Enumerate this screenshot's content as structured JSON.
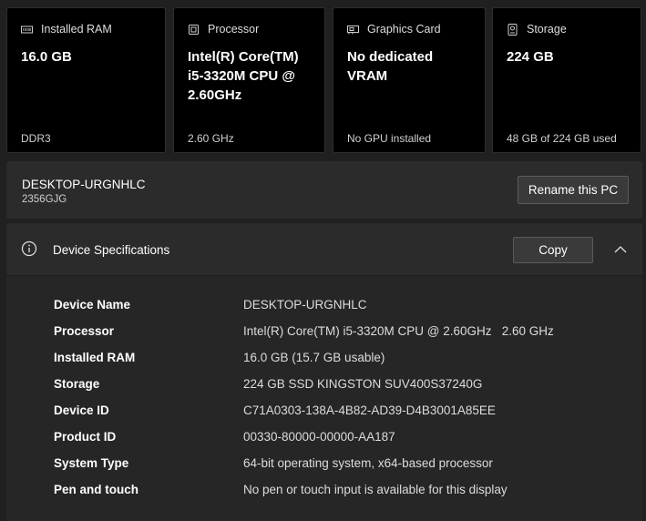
{
  "tiles": [
    {
      "icon": "ram-icon",
      "label": "Installed RAM",
      "value": "16.0 GB",
      "footer": "DDR3"
    },
    {
      "icon": "processor-icon",
      "label": "Processor",
      "value": "Intel(R) Core(TM) i5-3320M CPU @ 2.60GHz",
      "footer": "2.60 GHz"
    },
    {
      "icon": "graphics-card-icon",
      "label": "Graphics Card",
      "value": "No dedicated VRAM",
      "footer": "No GPU installed"
    },
    {
      "icon": "storage-icon",
      "label": "Storage",
      "value": "224 GB",
      "footer": "48 GB of 224 GB used"
    }
  ],
  "pc": {
    "name": "DESKTOP-URGNHLC",
    "model": "2356GJG",
    "rename_label": "Rename this PC"
  },
  "specs": {
    "title": "Device Specifications",
    "copy_label": "Copy",
    "rows": [
      {
        "key": "Device Name",
        "value": "DESKTOP-URGNHLC"
      },
      {
        "key": "Processor",
        "value": "Intel(R) Core(TM) i5-3320M CPU @ 2.60GHz   2.60 GHz"
      },
      {
        "key": "Installed RAM",
        "value": "16.0 GB (15.7 GB usable)"
      },
      {
        "key": "Storage",
        "value": "224 GB SSD KINGSTON SUV400S37240G"
      },
      {
        "key": "Device ID",
        "value": "C71A0303-138A-4B82-AD39-D4B3001A85EE"
      },
      {
        "key": "Product ID",
        "value": "00330-80000-00000-AA187"
      },
      {
        "key": "System Type",
        "value": "64-bit operating system, x64-based processor"
      },
      {
        "key": "Pen and touch",
        "value": "No pen or touch input is available for this display"
      }
    ]
  }
}
